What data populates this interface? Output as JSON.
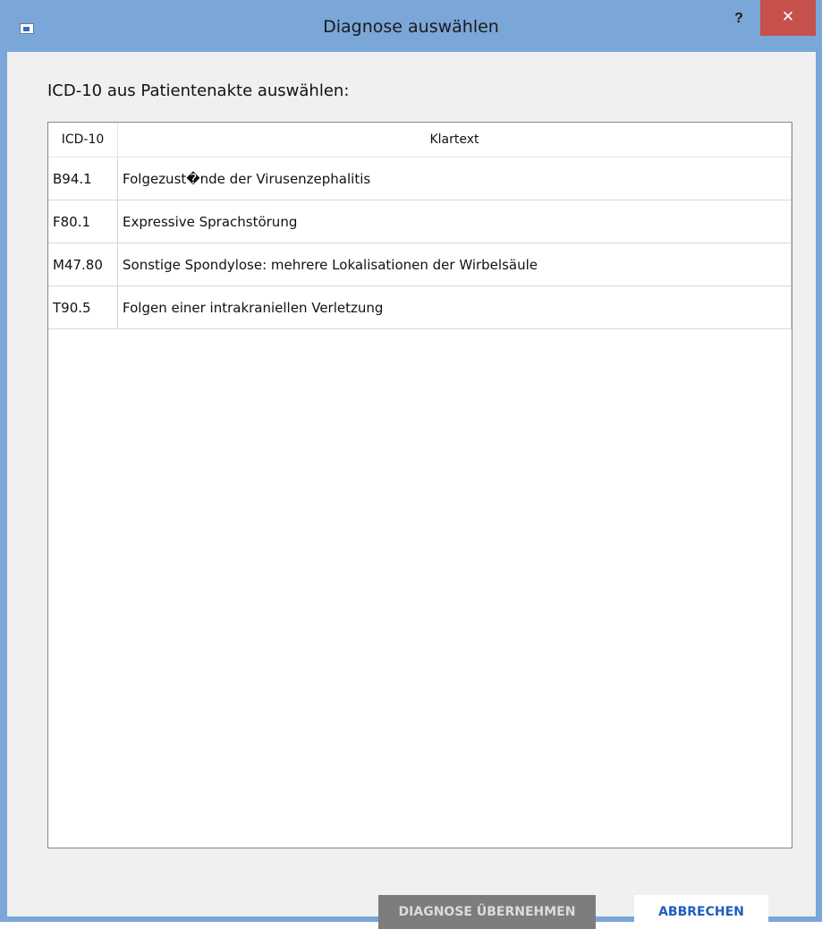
{
  "window": {
    "title": "Diagnose auswählen",
    "help_label": "?",
    "close_label": "✕"
  },
  "dialog": {
    "prompt": "ICD-10 aus Patientenakte auswählen:"
  },
  "table": {
    "columns": [
      "ICD-10",
      "Klartext"
    ],
    "rows": [
      {
        "code": "B94.1",
        "text": "Folgezust�nde der Virusenzephalitis"
      },
      {
        "code": "F80.1",
        "text": "Expressive Sprachstörung"
      },
      {
        "code": "M47.80",
        "text": "Sonstige Spondylose: mehrere Lokalisationen der Wirbelsäule"
      },
      {
        "code": "T90.5",
        "text": "Folgen einer intrakraniellen Verletzung"
      }
    ]
  },
  "buttons": {
    "apply_label": "DIAGNOSE ÜBERNEHMEN",
    "apply_enabled": false,
    "cancel_label": "ABBRECHEN"
  },
  "colors": {
    "titlebar": "#7aa6d8",
    "close_button": "#c7514b",
    "client_background": "#f0f0f0",
    "apply_button_disabled": "#7d7d7d",
    "cancel_text": "#1e5fbf"
  }
}
